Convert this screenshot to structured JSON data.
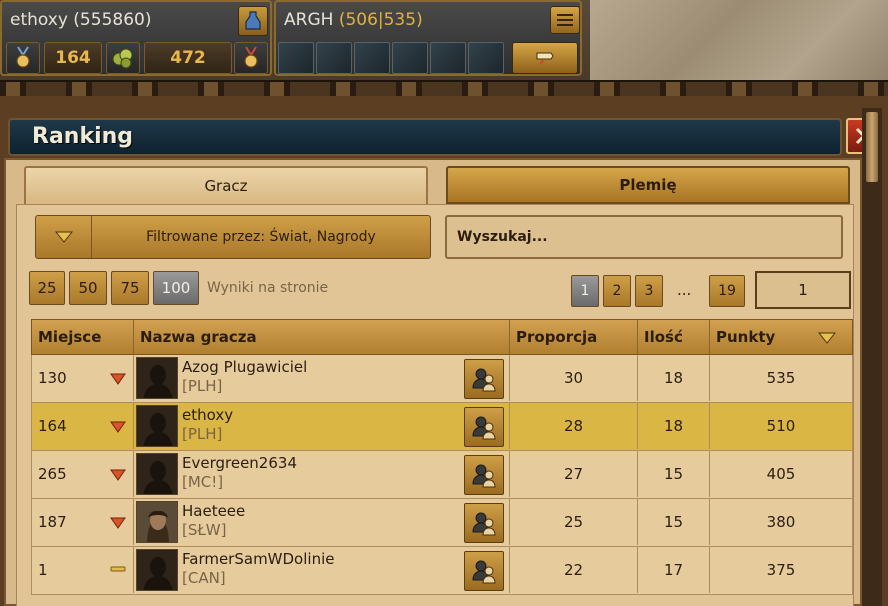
{
  "player": {
    "name": "ethoxy (555860)",
    "resource1": "164",
    "resource2": "472"
  },
  "tribe": {
    "name": "ARGH",
    "points": "(506|535)"
  },
  "window": {
    "title": "Ranking"
  },
  "tabs": [
    {
      "label": "Gracz",
      "active": true
    },
    {
      "label": "Plemię",
      "active": false
    }
  ],
  "filter": {
    "label": "Filtrowane przez: Świat, Nagrody"
  },
  "search": {
    "placeholder": "Wyszukaj..."
  },
  "per_page": {
    "options": [
      "25",
      "50",
      "75",
      "100"
    ],
    "selected": "100",
    "label": "Wyniki na stronie"
  },
  "pagination": {
    "pages": [
      "1",
      "2",
      "3"
    ],
    "ellipsis": "...",
    "last": "19",
    "current": "1",
    "input_value": "1"
  },
  "table": {
    "headers": {
      "rank": "Miejsce",
      "name": "Nazwa gracza",
      "ratio": "Proporcja",
      "count": "Ilość",
      "points": "Punkty"
    },
    "rows": [
      {
        "rank": "130",
        "trend": "down",
        "name": "Azog Plugawiciel",
        "tag": "[PLH]",
        "ratio": "30",
        "count": "18",
        "points": "535",
        "avatar": "silhouette"
      },
      {
        "rank": "164",
        "trend": "down",
        "name": "ethoxy",
        "tag": "[PLH]",
        "ratio": "28",
        "count": "18",
        "points": "510",
        "avatar": "silhouette",
        "highlight": true
      },
      {
        "rank": "265",
        "trend": "down",
        "name": "Evergreen2634",
        "tag": "[MC!]",
        "ratio": "27",
        "count": "15",
        "points": "405",
        "avatar": "silhouette"
      },
      {
        "rank": "187",
        "trend": "down",
        "name": "Haeteee",
        "tag": "[SŁW]",
        "ratio": "25",
        "count": "15",
        "points": "380",
        "avatar": "portrait"
      },
      {
        "rank": "1",
        "trend": "same",
        "name": "FarmerSamWDolinie",
        "tag": "[CAN]",
        "ratio": "22",
        "count": "17",
        "points": "375",
        "avatar": "silhouette"
      }
    ]
  },
  "colors": {
    "highlight_row": "#dab644",
    "trend_down": "#d8542a",
    "trend_same": "#e8b84a"
  }
}
